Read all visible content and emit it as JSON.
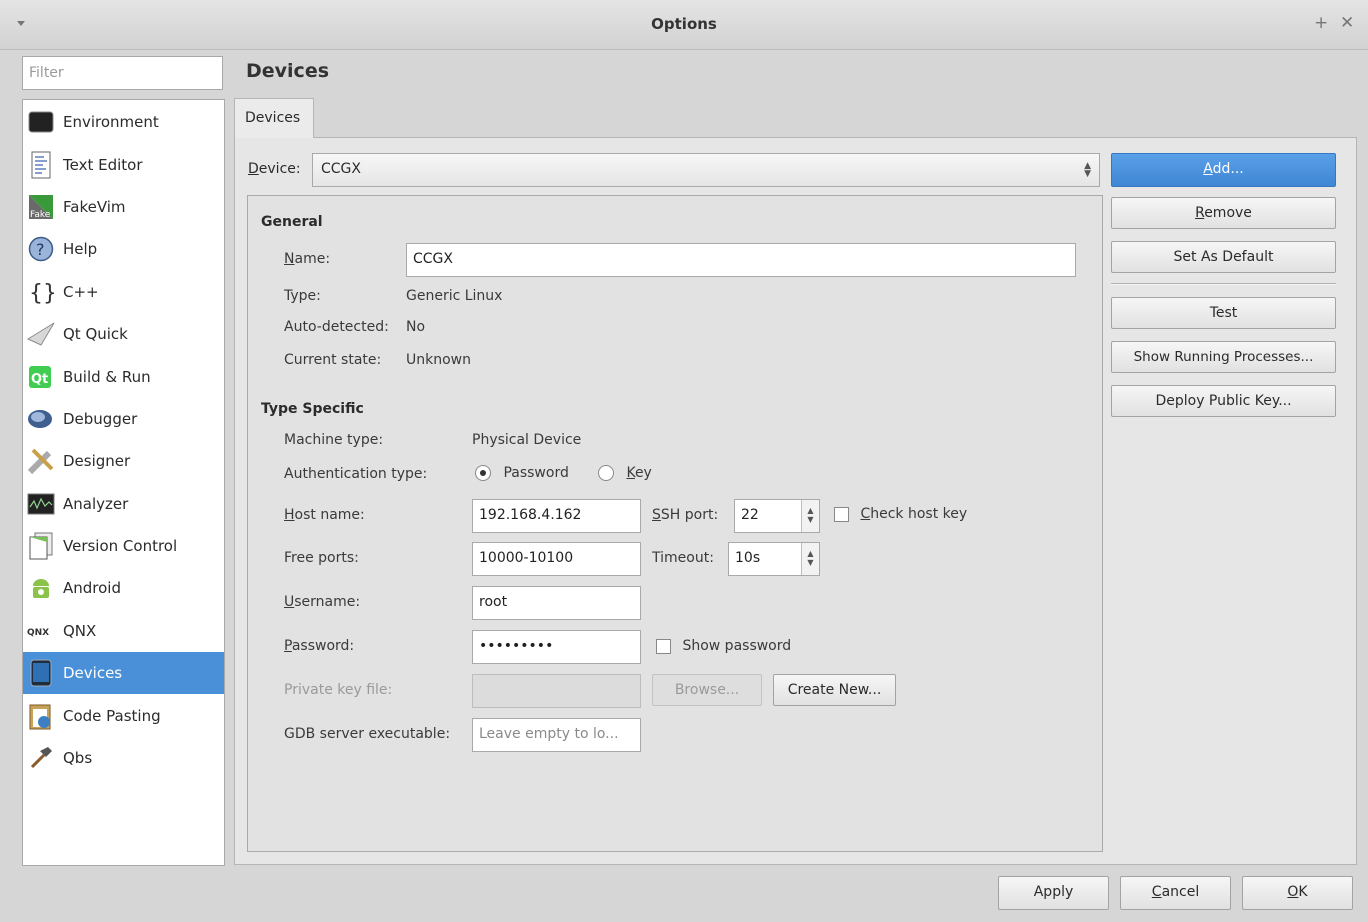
{
  "window": {
    "title": "Options"
  },
  "filter": {
    "placeholder": "Filter"
  },
  "categories": [
    {
      "label": "Environment",
      "icon": "monitor-icon"
    },
    {
      "label": "Text Editor",
      "icon": "text-document-icon"
    },
    {
      "label": "FakeVim",
      "icon": "fakevim-icon"
    },
    {
      "label": "Help",
      "icon": "help-icon"
    },
    {
      "label": "C++",
      "icon": "braces-icon"
    },
    {
      "label": "Qt Quick",
      "icon": "paper-plane-icon"
    },
    {
      "label": "Build & Run",
      "icon": "qt-build-icon"
    },
    {
      "label": "Debugger",
      "icon": "bug-icon"
    },
    {
      "label": "Designer",
      "icon": "pencil-ruler-icon"
    },
    {
      "label": "Analyzer",
      "icon": "waveform-icon"
    },
    {
      "label": "Version Control",
      "icon": "documents-icon"
    },
    {
      "label": "Android",
      "icon": "android-icon"
    },
    {
      "label": "QNX",
      "icon": "qnx-logo-icon"
    },
    {
      "label": "Devices",
      "icon": "tablet-icon"
    },
    {
      "label": "Code Pasting",
      "icon": "clipboard-icon"
    },
    {
      "label": "Qbs",
      "icon": "hammer-icon"
    }
  ],
  "page": {
    "title": "Devices",
    "tab": "Devices",
    "device_label_prefix": "D",
    "device_label_rest": "evice:",
    "device_value": "CCGX"
  },
  "general": {
    "title": "General",
    "name_label_u": "N",
    "name_label_rest": "ame:",
    "name_value": "CCGX",
    "type_label": "Type:",
    "type_value": "Generic Linux",
    "auto_label": "Auto-detected:",
    "auto_value": "No",
    "state_label": "Current state:",
    "state_value": "Unknown"
  },
  "type_specific": {
    "title": "Type Specific",
    "machine_label": "Machine type:",
    "machine_value": "Physical Device",
    "auth_label": "Authentication type:",
    "auth_password": "Password",
    "auth_key_u": "K",
    "auth_key_rest": "ey",
    "host_label_u": "H",
    "host_label_rest": "ost name:",
    "host_value": "192.168.4.162",
    "ssh_label_u": "S",
    "ssh_label_rest": "SH port:",
    "ssh_value": "22",
    "check_host_u": "C",
    "check_host_rest": "heck host key",
    "ports_label": "Free ports:",
    "ports_value": "10000-10100",
    "timeout_label": "Timeout:",
    "timeout_value": "10s",
    "user_label_u": "U",
    "user_label_rest": "sername:",
    "user_value": "root",
    "pass_label_u": "P",
    "pass_label_rest": "assword:",
    "pass_value": "•••••••••",
    "show_password": "Show password",
    "key_label": "Private key file:",
    "browse": "Browse...",
    "create_new": "Create New...",
    "gdb_label": "GDB server executable:",
    "gdb_placeholder": "Leave empty to lo..."
  },
  "side_buttons": {
    "add_u": "A",
    "add_rest": "dd...",
    "remove_u": "R",
    "remove_rest": "emove",
    "set_default": "Set As Default",
    "test": "Test",
    "show_processes": "Show Running Processes...",
    "deploy_key": "Deploy Public Key..."
  },
  "footer": {
    "apply": "Apply",
    "cancel_u": "C",
    "cancel_rest": "ancel",
    "ok_u": "O",
    "ok_rest": "K"
  },
  "colors": {
    "selection": "#4a90d9",
    "primary_button": "#4a90d9"
  }
}
